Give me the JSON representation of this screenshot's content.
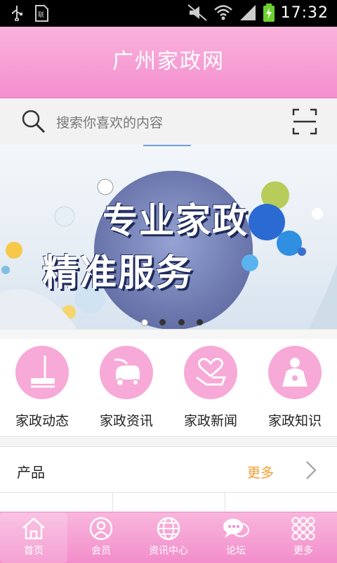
{
  "status_bar": {
    "time": "17:32"
  },
  "header": {
    "title": "广州家政网"
  },
  "search": {
    "placeholder": "搜索你喜欢的内容"
  },
  "banner": {
    "line1": "专业家政",
    "line2": "精准服务",
    "slide_count": 4,
    "active_slide": 1
  },
  "categories": [
    {
      "label": "家政动态",
      "icon": "mop-icon"
    },
    {
      "label": "家政资讯",
      "icon": "vacuum-icon"
    },
    {
      "label": "家政新闻",
      "icon": "heart-hand-icon"
    },
    {
      "label": "家政知识",
      "icon": "maid-icon"
    }
  ],
  "products": {
    "title": "产品",
    "more": "更多"
  },
  "tabbar": {
    "items": [
      {
        "label": "首页",
        "icon": "home-icon"
      },
      {
        "label": "会员",
        "icon": "member-icon"
      },
      {
        "label": "资讯中心",
        "icon": "globe-icon"
      },
      {
        "label": "论坛",
        "icon": "chat-icon"
      },
      {
        "label": "更多",
        "icon": "grid-icon"
      }
    ],
    "active": 0
  },
  "colors": {
    "pink": "#f48fcf",
    "accent_orange": "#f39a2e"
  }
}
